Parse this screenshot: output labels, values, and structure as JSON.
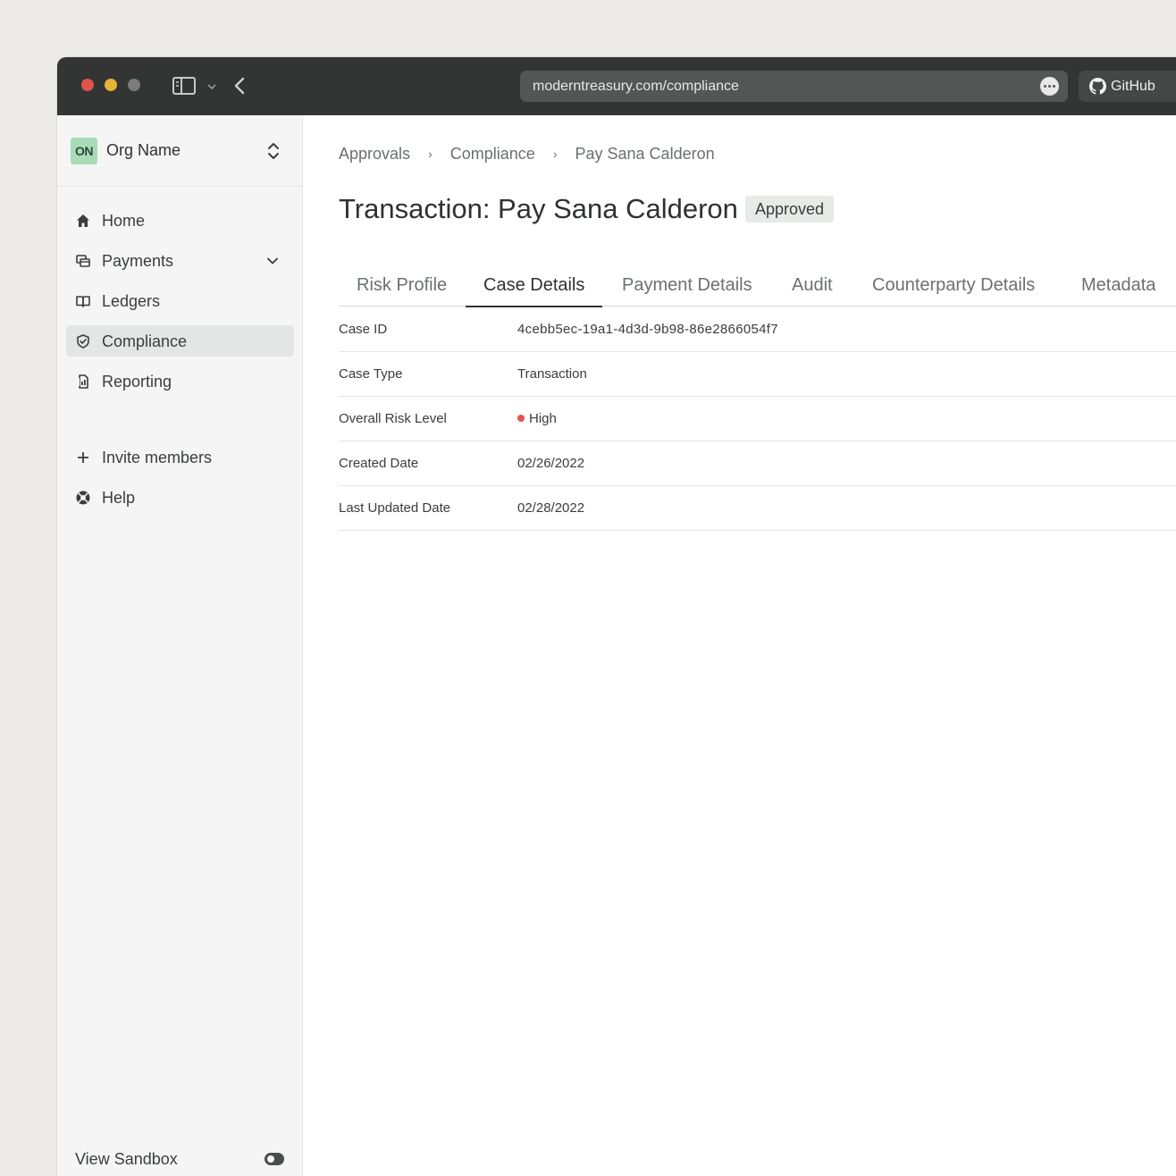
{
  "browser": {
    "url": "moderntreasury.com/compliance",
    "github_label": "GitHub"
  },
  "sidebar": {
    "org_badge": "ON",
    "org_name": "Org Name",
    "items": [
      {
        "label": "Home",
        "icon": "home-icon"
      },
      {
        "label": "Payments",
        "icon": "payments-icon"
      },
      {
        "label": "Ledgers",
        "icon": "book-icon"
      },
      {
        "label": "Compliance",
        "icon": "shield-icon",
        "active": true
      },
      {
        "label": "Reporting",
        "icon": "report-icon"
      }
    ],
    "invite_label": "Invite members",
    "help_label": "Help",
    "sandbox_label": "View Sandbox"
  },
  "breadcrumb": [
    "Approvals",
    "Compliance",
    "Pay Sana Calderon"
  ],
  "page": {
    "title": "Transaction: Pay Sana Calderon",
    "status": "Approved"
  },
  "tabs": [
    "Risk Profile",
    "Case Details",
    "Payment Details",
    "Audit",
    "Counterparty Details",
    "Metadata"
  ],
  "active_tab": "Case Details",
  "details": [
    {
      "key": "Case ID",
      "value": "4cebb5ec-19a1-4d3d-9b98-86e2866054f7"
    },
    {
      "key": "Case Type",
      "value": "Transaction"
    },
    {
      "key": "Overall Risk Level",
      "value": "High"
    },
    {
      "key": "Created Date",
      "value": "02/26/2022"
    },
    {
      "key": "Last Updated Date",
      "value": "02/28/2022"
    }
  ],
  "colors": {
    "risk_high": "#e05550",
    "titlebar": "#333434",
    "org_badge": "#a8dcb9"
  }
}
